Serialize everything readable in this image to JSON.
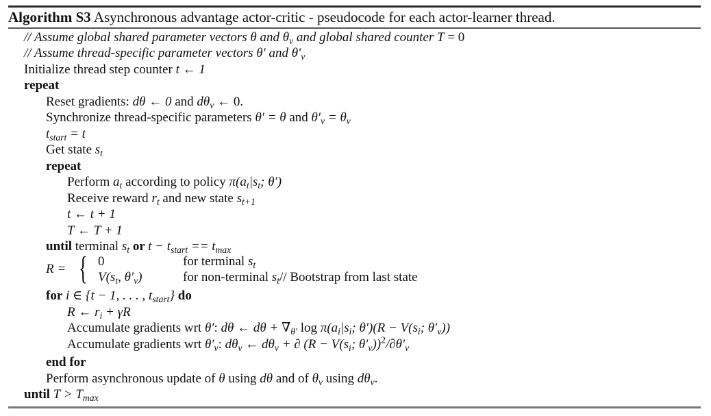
{
  "algorithm": {
    "label": "Algorithm S3",
    "title": "Asynchronous advantage actor-critic - pseudocode for each actor-learner thread."
  },
  "lines": {
    "c1_a": "// Assume global shared parameter vectors ",
    "c1_b": " and ",
    "c1_c": " and global shared counter ",
    "c1_d": " = 0",
    "c2_a": "// Assume thread-specific parameter vectors ",
    "c2_b": " and ",
    "init_text": "Initialize thread step counter ",
    "init_math": "t ← 1",
    "repeat_outer": "repeat",
    "reset_text": "Reset gradients: ",
    "reset_a": "dθ ← 0",
    "reset_and": " and ",
    "reset_b": "dθ",
    "reset_b2": " ← 0.",
    "sync_text": "Synchronize thread-specific parameters ",
    "sync_a": "θ′ = θ",
    "sync_and": " and ",
    "tstart_lhs": "t",
    "tstart_sub": "start",
    "tstart_rhs": " = t",
    "getstate_text": "Get state ",
    "repeat_inner": "repeat",
    "perform_text": "Perform ",
    "perform_mid": " according to policy ",
    "receive_text": "Receive reward ",
    "receive_mid": " and new state ",
    "t_inc": "t ← t + 1",
    "T_inc": "T ← T + 1",
    "until_kw": "until",
    "until_mid": " terminal ",
    "or_kw": " or ",
    "R_lhs": "R =",
    "case1_value": "0",
    "case1_cond": "for terminal ",
    "case2_cond": "for non-terminal ",
    "case2_comment": "// Bootstrap from last state",
    "for_kw": "for",
    "do_kw": " do",
    "R_update": "R ← r",
    "R_update_tail": " + γR",
    "acc1_text": "Accumulate gradients wrt ",
    "acc2_text": "Accumulate gradients wrt ",
    "endfor_kw": "end for",
    "async_text_a": "Perform asynchronous update of ",
    "async_text_b": " using ",
    "async_text_c": " and of ",
    "async_text_d": " using ",
    "until_final_kw": "until",
    "until_final_math": " T > T"
  }
}
